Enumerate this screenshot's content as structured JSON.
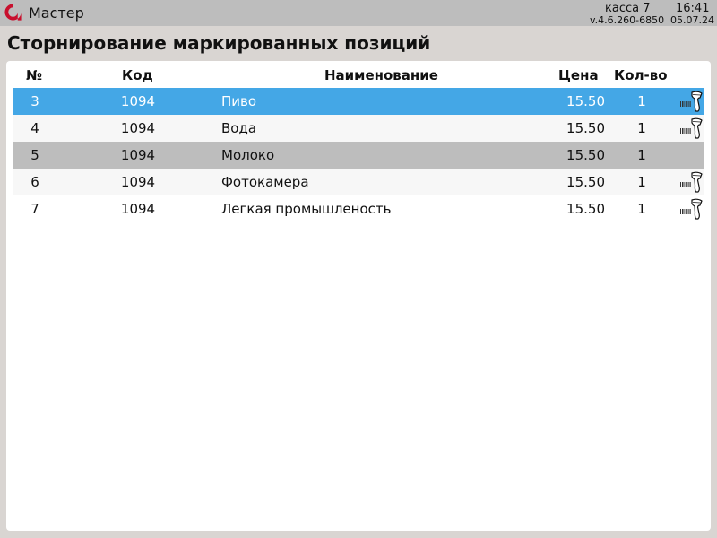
{
  "topbar": {
    "app_title": "Мастер",
    "register": "касса 7",
    "time": "16:41",
    "version": "v.4.6.260-6850",
    "date": "05.07.24"
  },
  "page_title": "Сторнирование маркированных позиций",
  "table": {
    "headers": {
      "num": "№",
      "code": "Код",
      "name": "Наименование",
      "price": "Цена",
      "qty": "Кол-во"
    },
    "rows": [
      {
        "num": "3",
        "code": "1094",
        "name": "Пиво",
        "price": "15.50",
        "qty": "1",
        "marked": true,
        "state": "selected"
      },
      {
        "num": "4",
        "code": "1094",
        "name": "Вода",
        "price": "15.50",
        "qty": "1",
        "marked": true,
        "state": "normal"
      },
      {
        "num": "5",
        "code": "1094",
        "name": "Молоко",
        "price": "15.50",
        "qty": "1",
        "marked": false,
        "state": "unmarked"
      },
      {
        "num": "6",
        "code": "1094",
        "name": "Фотокамера",
        "price": "15.50",
        "qty": "1",
        "marked": true,
        "state": "normal"
      },
      {
        "num": "7",
        "code": "1094",
        "name": "Легкая промышленость",
        "price": "15.50",
        "qty": "1",
        "marked": true,
        "state": "normal"
      }
    ]
  },
  "icons": {
    "logo": "brand-logo-icon",
    "marked_item": "barcode-scanner-icon"
  },
  "colors": {
    "selected_row": "#44a7e6",
    "unmarked_row": "#bdbdbd",
    "logo_red": "#c8102e"
  }
}
